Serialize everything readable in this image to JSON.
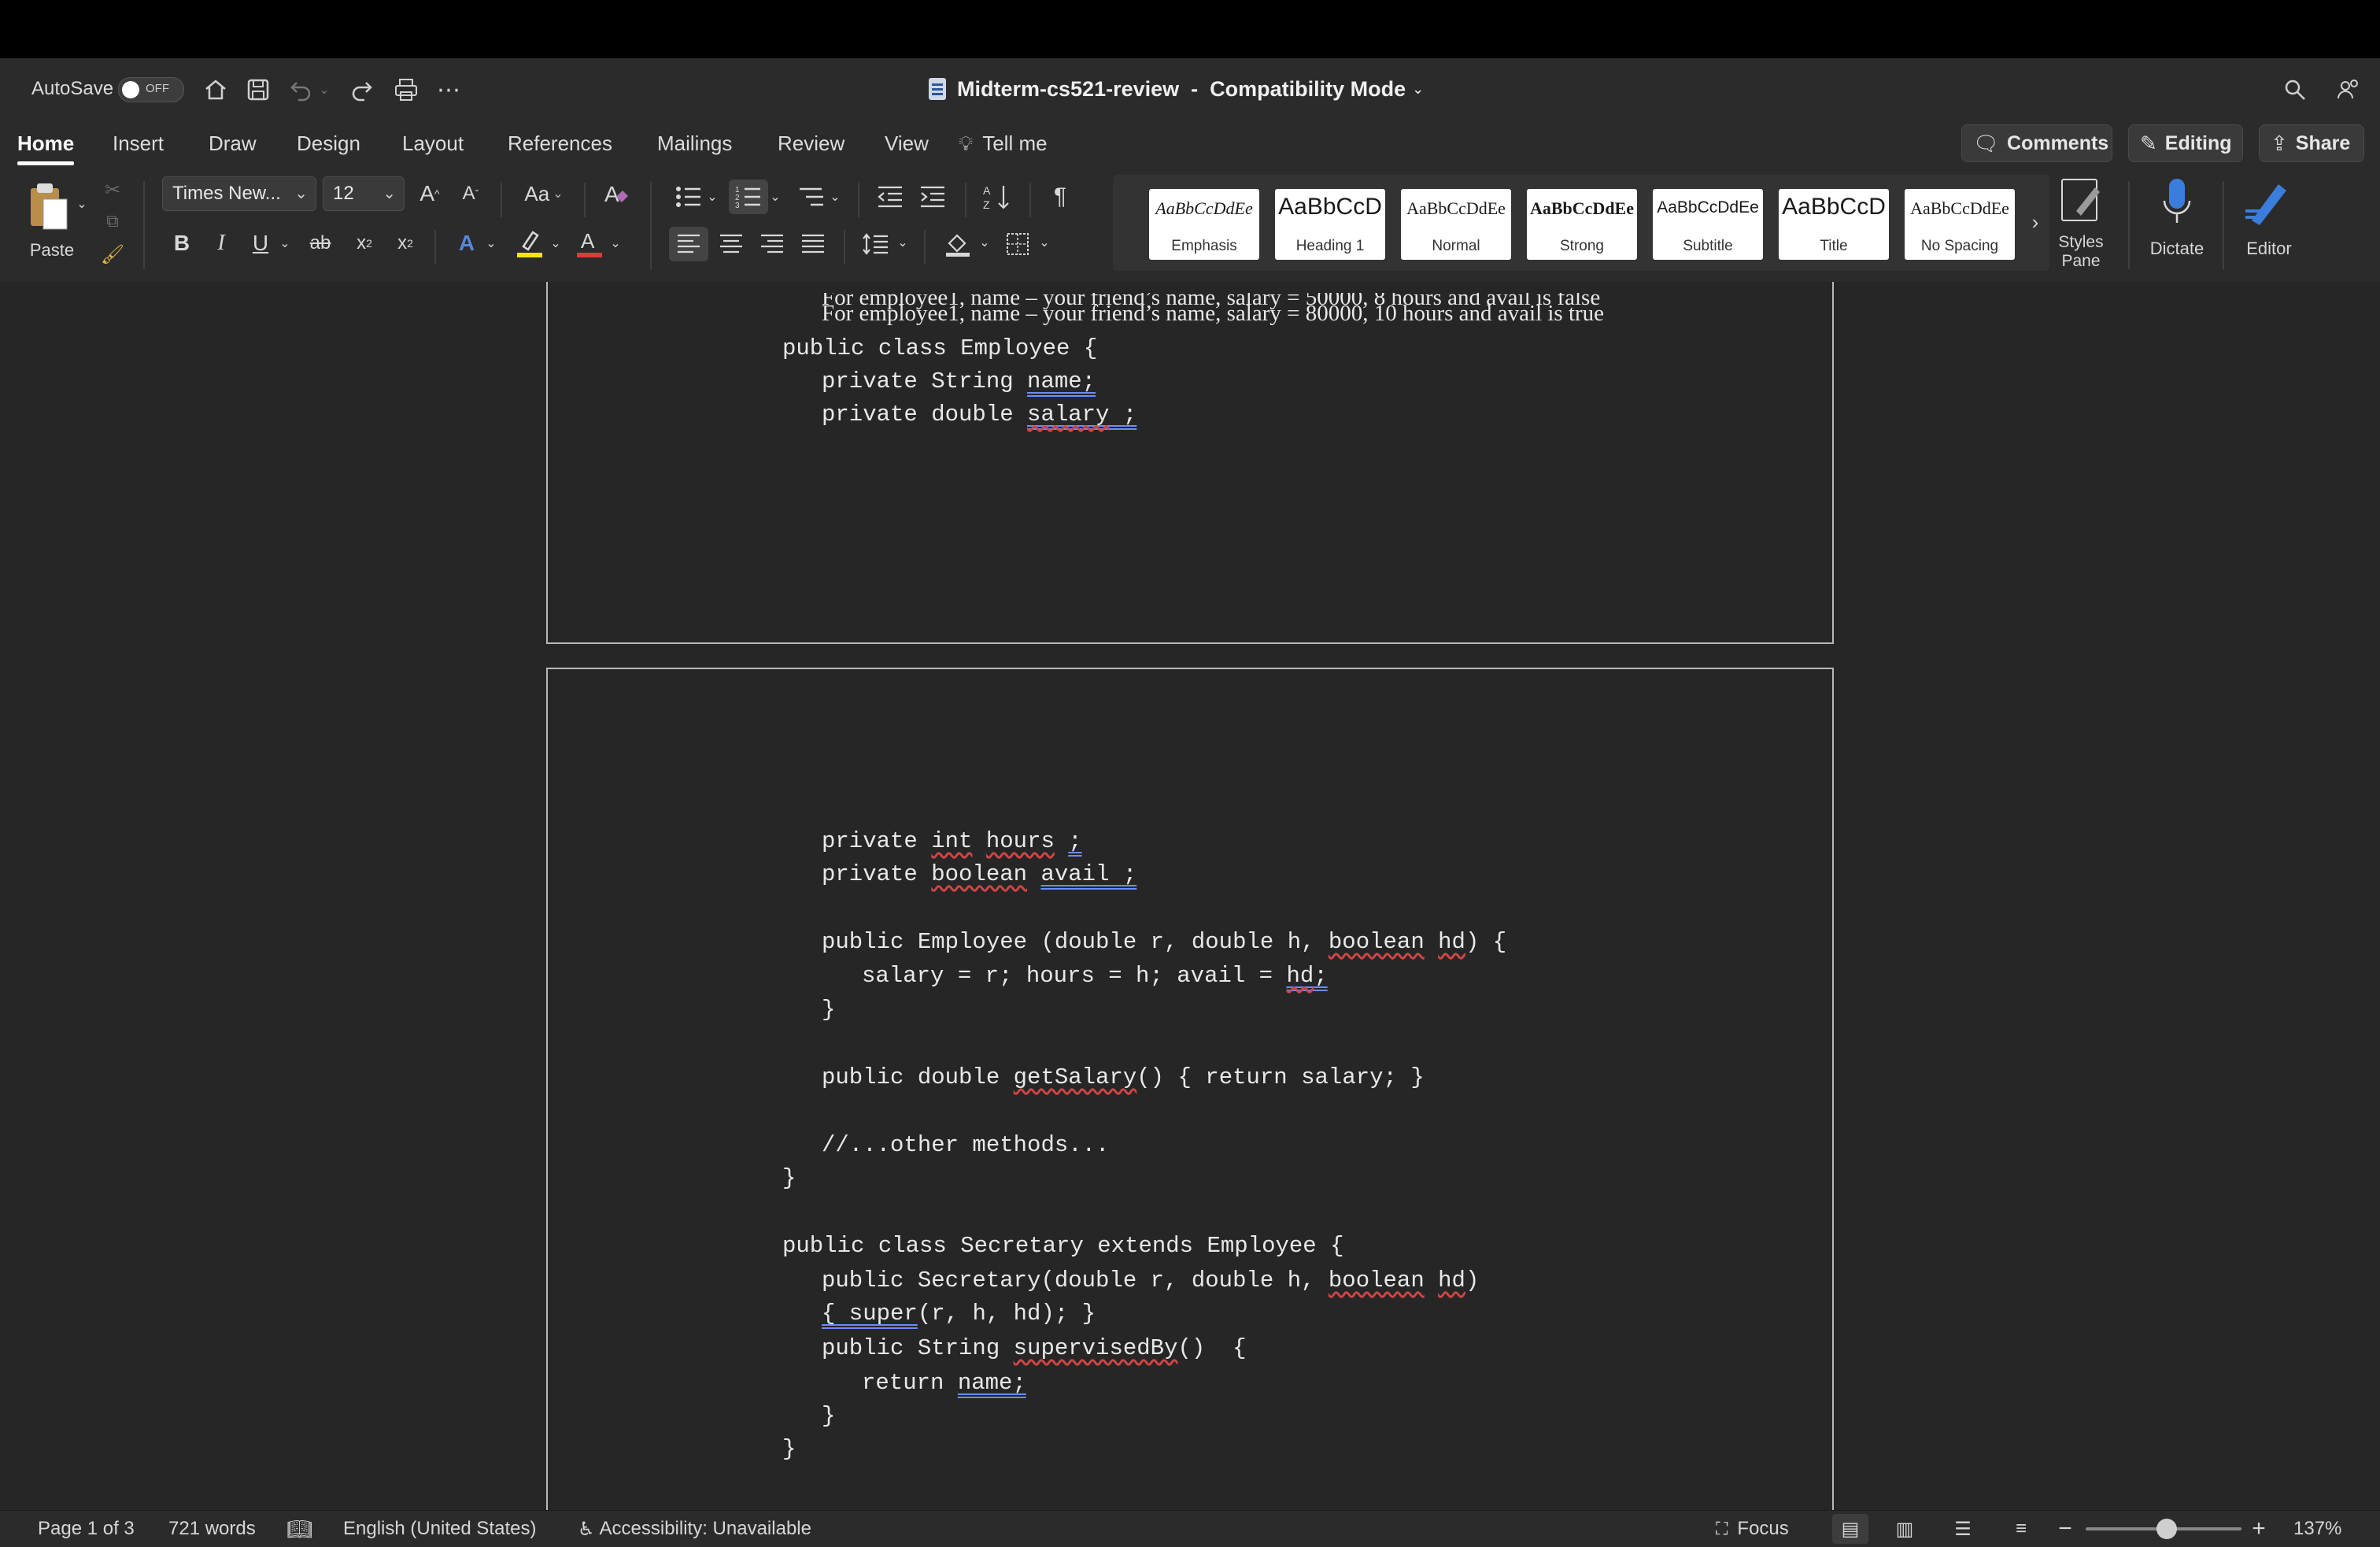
{
  "titlebar": {
    "autosave_label": "AutoSave",
    "autosave_state": "OFF",
    "document_title": "Midterm-cs521-review  -  Compatibility Mode"
  },
  "tabs": [
    "Home",
    "Insert",
    "Draw",
    "Design",
    "Layout",
    "References",
    "Mailings",
    "Review",
    "View",
    "Tell me"
  ],
  "active_tab": "Home",
  "actions": {
    "comments": "Comments",
    "editing": "Editing",
    "share": "Share"
  },
  "ribbon": {
    "paste_label": "Paste",
    "font_name": "Times New...",
    "font_size": "12",
    "case_label": "Aa",
    "styles": [
      {
        "preview": "AaBbCcDdEe",
        "label": "Emphasis"
      },
      {
        "preview": "AaBbCcD",
        "label": "Heading 1"
      },
      {
        "preview": "AaBbCcDdEe",
        "label": "Normal"
      },
      {
        "preview": "AaBbCcDdEe",
        "label": "Strong"
      },
      {
        "preview": "AaBbCcDdEe",
        "label": "Subtitle"
      },
      {
        "preview": "AaBbCcD",
        "label": "Title"
      },
      {
        "preview": "AaBbCcDdEe",
        "label": "No Spacing"
      }
    ],
    "styles_pane_label": "Styles Pane",
    "dictate_label": "Dictate",
    "editor_label": "Editor"
  },
  "document": {
    "page1_lines": [
      "For employee1, name – your friend’s name, salary = 50000, 8 hours and avail is false",
      "For employee1, name – your friend’s name, salary = 80000, 10 hours and avail is true",
      "public class Employee {",
      "private String name;",
      "private double salary ;"
    ],
    "page2_lines": [
      "private int hours ;",
      "private boolean avail ;",
      "public Employee (double r, double h, boolean hd) {",
      "salary = r; hours = h; avail = hd;",
      "}",
      "public double getSalary() { return salary; }",
      "//...other methods...",
      "}",
      "public class Secretary extends Employee {",
      "public Secretary(double r, double h, boolean hd)",
      "{ super(r, h, hd); }",
      "public String supervisedBy()  {",
      "return name;",
      "}",
      "}"
    ]
  },
  "statusbar": {
    "page": "Page 1 of 3",
    "words": "721 words",
    "language": "English (United States)",
    "accessibility": "Accessibility: Unavailable",
    "focus": "Focus",
    "zoom": "137%"
  },
  "colors": {
    "accent_blue": "#2b579a",
    "highlight_yellow": "#f5e50a",
    "font_color_red": "#e03a3a"
  }
}
